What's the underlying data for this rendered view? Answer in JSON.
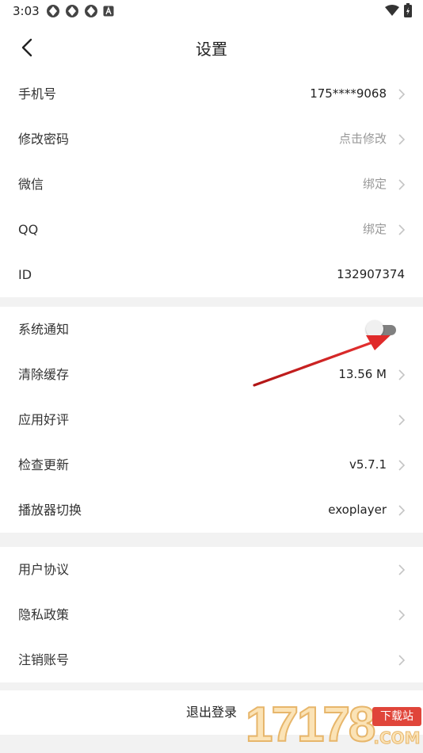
{
  "status_bar": {
    "time": "3:03"
  },
  "header": {
    "title": "设置"
  },
  "account_group": [
    {
      "label": "手机号",
      "value": "175****9068",
      "muted": false,
      "arrow": true
    },
    {
      "label": "修改密码",
      "value": "点击修改",
      "muted": true,
      "arrow": true
    },
    {
      "label": "微信",
      "value": "绑定",
      "muted": true,
      "arrow": true
    },
    {
      "label": "QQ",
      "value": "绑定",
      "muted": true,
      "arrow": true
    },
    {
      "label": "ID",
      "value": "132907374",
      "muted": false,
      "arrow": false
    }
  ],
  "app_group": {
    "notification_label": "系统通知",
    "notification_enabled": false,
    "rows": [
      {
        "label": "清除缓存",
        "value": "13.56 M"
      },
      {
        "label": "应用好评",
        "value": ""
      },
      {
        "label": "检查更新",
        "value": "v5.7.1"
      },
      {
        "label": "播放器切换",
        "value": "exoplayer"
      }
    ]
  },
  "legal_group": [
    {
      "label": "用户协议"
    },
    {
      "label": "隐私政策"
    },
    {
      "label": "注销账号"
    }
  ],
  "logout": {
    "label": "退出登录"
  },
  "watermark": {
    "digits": "17178",
    "badge": "下载站",
    "suffix": ".COM"
  },
  "colors": {
    "page_bg": "#f2f2f2",
    "card_bg": "#ffffff",
    "muted_text": "#999999",
    "annotation_arrow": "#d92020",
    "toggle_off_track": "#808080"
  }
}
